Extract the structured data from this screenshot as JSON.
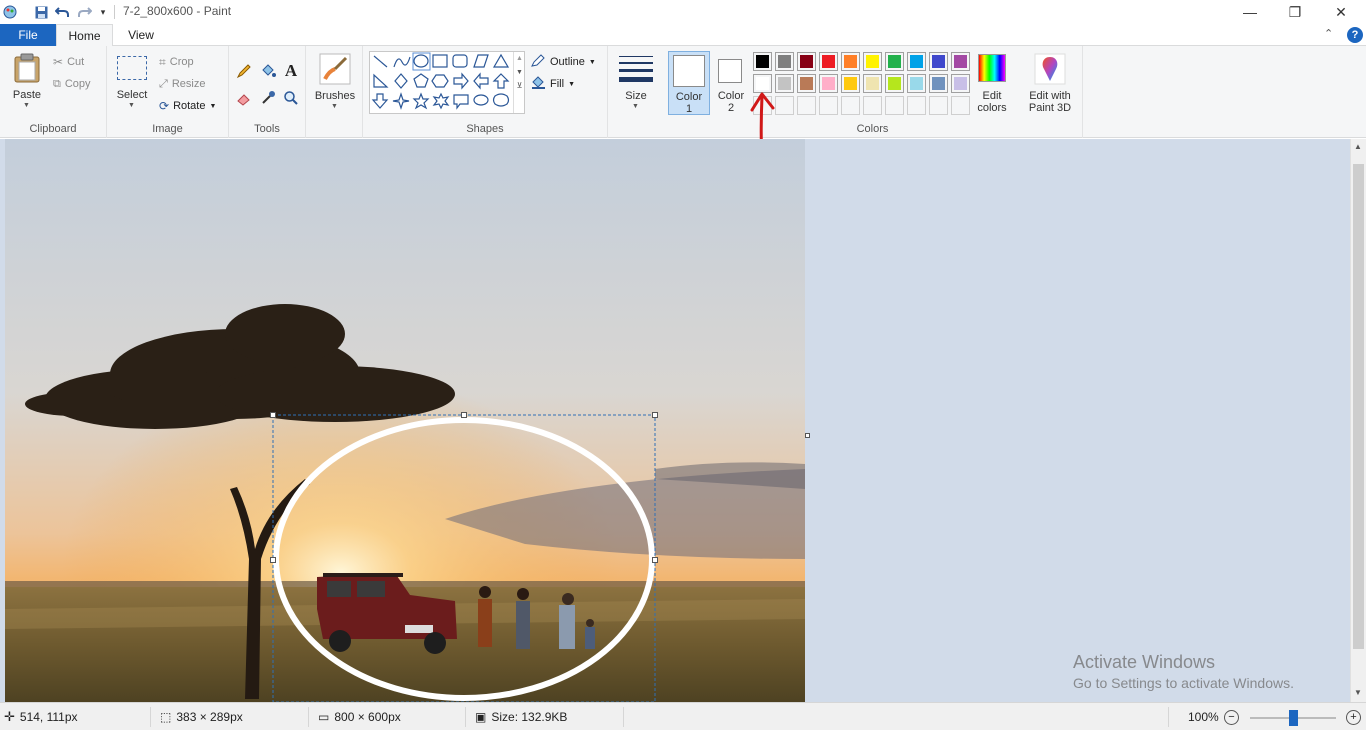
{
  "window": {
    "title": "7-2_800x600 - Paint",
    "minimize": "—",
    "restore": "❐",
    "close": "✕"
  },
  "tabs": {
    "file": "File",
    "home": "Home",
    "view": "View"
  },
  "ribbon": {
    "collapse": "⌃",
    "help": "?",
    "clipboard": {
      "label": "Clipboard",
      "paste": "Paste",
      "cut": "Cut",
      "copy": "Copy"
    },
    "image": {
      "label": "Image",
      "select": "Select",
      "crop": "Crop",
      "resize": "Resize",
      "rotate": "Rotate"
    },
    "tools": {
      "label": "Tools"
    },
    "brushes": "Brushes",
    "shapes": {
      "label": "Shapes",
      "outline": "Outline",
      "fill": "Fill"
    },
    "size": "Size",
    "colors": {
      "label": "Colors",
      "color1_line1": "Color",
      "color1_line2": "1",
      "color2_line1": "Color",
      "color2_line2": "2",
      "edit_line1": "Edit",
      "edit_line2": "colors",
      "paint3d_line1": "Edit with",
      "paint3d_line2": "Paint 3D",
      "palette_row1": [
        "#000000",
        "#7f7f7f",
        "#880015",
        "#ed1c24",
        "#ff7f27",
        "#fff200",
        "#22b14c",
        "#00a2e8",
        "#3f48cc",
        "#a349a4"
      ],
      "palette_row2": [
        "#ffffff",
        "#c3c3c3",
        "#b97a57",
        "#ffaec9",
        "#ffc90e",
        "#efe4b0",
        "#b5e61d",
        "#99d9ea",
        "#7092be",
        "#c8bfe7"
      ]
    }
  },
  "status": {
    "cursor_pos": "514, 111px",
    "selection_size": "383 × 289px",
    "image_size": "800 × 600px",
    "file_size": "Size: 132.9KB",
    "zoom": "100%",
    "zoom_level": 1.0
  },
  "watermark": {
    "title": "Activate Windows",
    "subtitle": "Go to Settings to activate Windows."
  }
}
